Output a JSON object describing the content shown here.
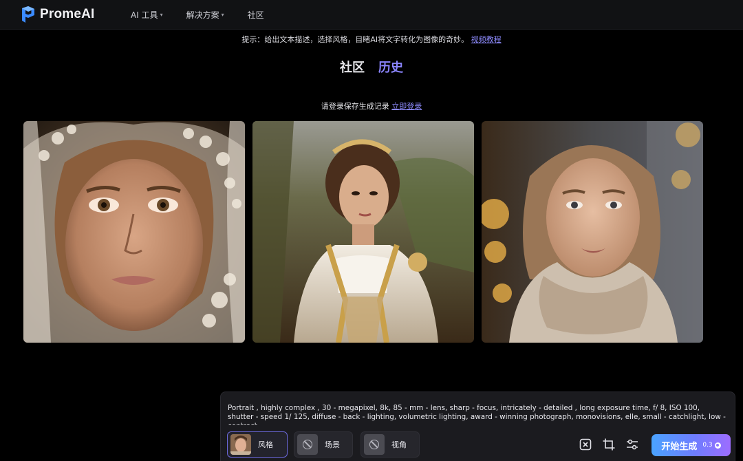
{
  "header": {
    "logo_text": "PromeAI",
    "nav": [
      {
        "label": "AI 工具",
        "has_dropdown": true
      },
      {
        "label": "解决方案",
        "has_dropdown": true
      },
      {
        "label": "社区",
        "has_dropdown": false
      }
    ]
  },
  "intro": {
    "tip_text": "提示：给出文本描述，选择风格，目睹AI将文字转化为图像的奇妙。",
    "tutorial_link": "视频教程"
  },
  "tabs": [
    {
      "label": "社区",
      "active": false
    },
    {
      "label": "历史",
      "active": true
    }
  ],
  "login_notice": {
    "text": "请登录保存生成记录",
    "link": "立即登录"
  },
  "prompt": {
    "text": "Portrait , highly complex , 30 - megapixel, 8k, 85 - mm - lens, sharp - focus, intricately - detailed , long exposure time, f/ 8, ISO 100, shutter - speed 1/ 125, diffuse - back - lighting, volumetric lighting, award - winning photograph, monovisions, elle, small - catchlight, low - contrast,"
  },
  "options": [
    {
      "label": "风格",
      "selected": true
    },
    {
      "label": "场景",
      "selected": false
    },
    {
      "label": "视角",
      "selected": false
    }
  ],
  "generate": {
    "label": "开始生成",
    "cost": "0.3"
  },
  "colors": {
    "accent": "#8b85ff",
    "background": "#000000",
    "panel": "#1b1b1f",
    "header": "#111214"
  },
  "icons": {
    "clear": "close-box-icon",
    "crop": "crop-icon",
    "settings": "sliders-icon",
    "none": "ban-icon",
    "currency": "coin-icon"
  }
}
